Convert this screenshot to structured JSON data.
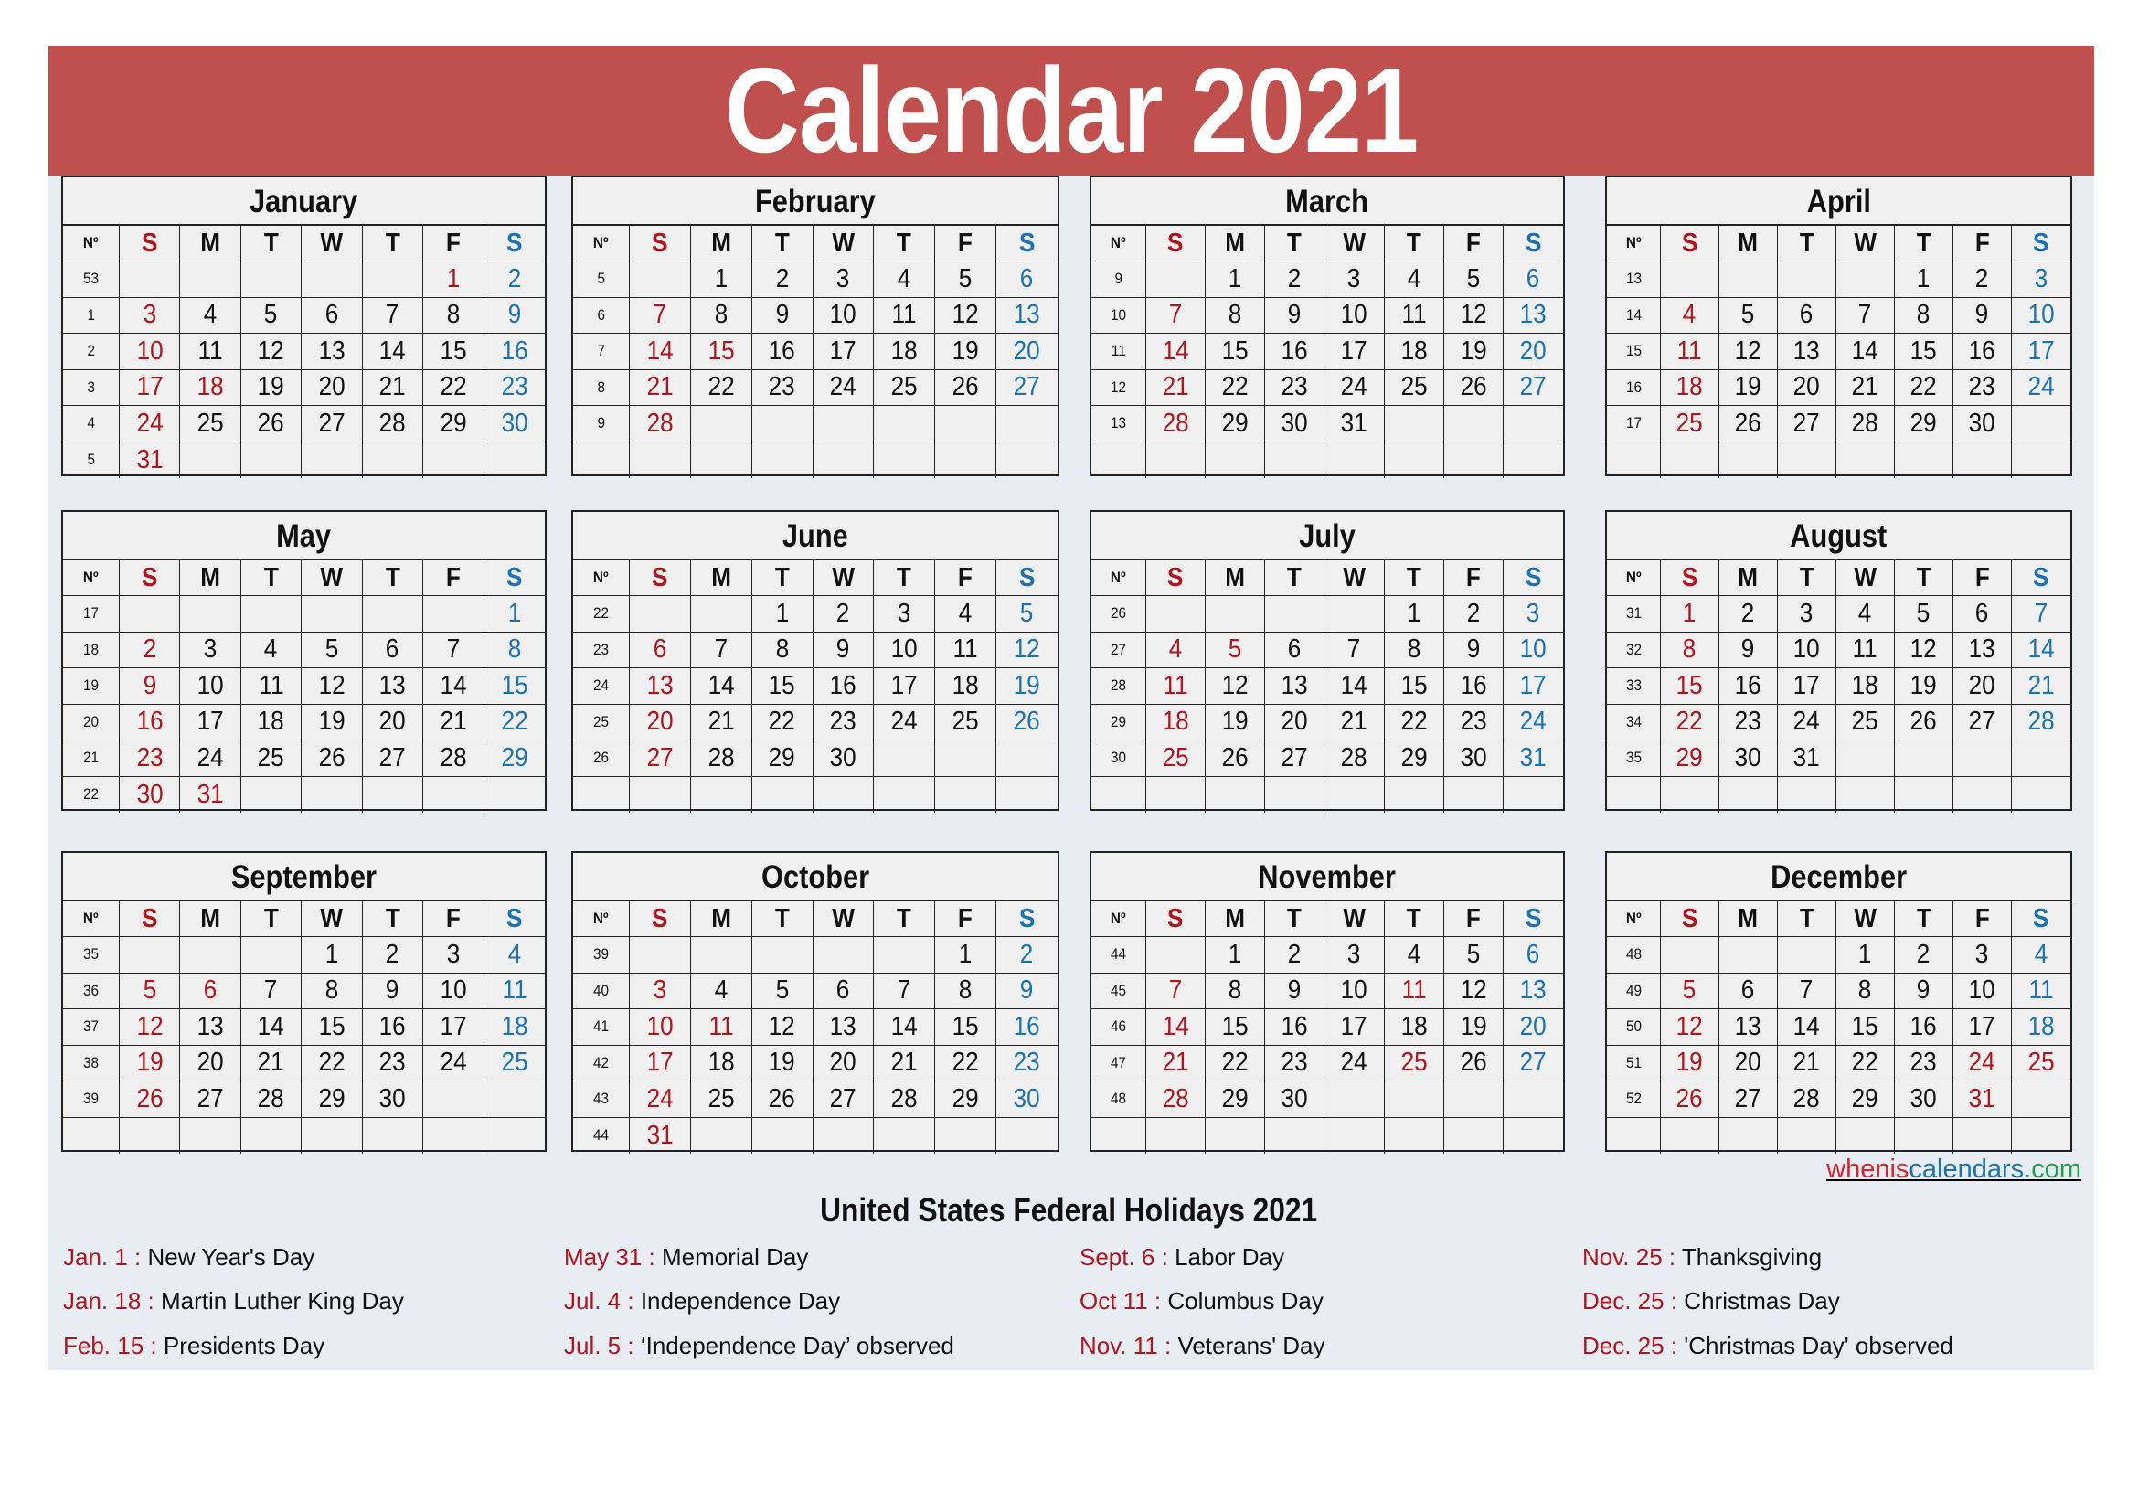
{
  "title": "Calendar 2021",
  "colors": {
    "banner": "#c0504d",
    "background": "#e8ecf3",
    "cell": "#f0f0f0",
    "sunday": "#b0141c",
    "saturday": "#1c72b0",
    "holiday": "#b0141c"
  },
  "weekday_headers": [
    "Nº",
    "S",
    "M",
    "T",
    "W",
    "T",
    "F",
    "S"
  ],
  "months": [
    {
      "name": "January",
      "weeks": [
        53,
        1,
        2,
        3,
        4,
        5
      ],
      "first_weekday": 5,
      "days": 31,
      "holidays": [
        1,
        18
      ]
    },
    {
      "name": "February",
      "weeks": [
        5,
        6,
        7,
        8,
        9,
        ""
      ],
      "first_weekday": 1,
      "days": 28,
      "holidays": [
        15
      ]
    },
    {
      "name": "March",
      "weeks": [
        9,
        10,
        11,
        12,
        13,
        ""
      ],
      "first_weekday": 1,
      "days": 31,
      "holidays": []
    },
    {
      "name": "April",
      "weeks": [
        13,
        14,
        15,
        16,
        17,
        ""
      ],
      "first_weekday": 4,
      "days": 30,
      "holidays": []
    },
    {
      "name": "May",
      "weeks": [
        17,
        18,
        19,
        20,
        21,
        22
      ],
      "first_weekday": 6,
      "days": 31,
      "holidays": [
        31
      ]
    },
    {
      "name": "June",
      "weeks": [
        22,
        23,
        24,
        25,
        26,
        ""
      ],
      "first_weekday": 2,
      "days": 30,
      "holidays": []
    },
    {
      "name": "July",
      "weeks": [
        26,
        27,
        28,
        29,
        30,
        ""
      ],
      "first_weekday": 4,
      "days": 31,
      "holidays": [
        4,
        5
      ]
    },
    {
      "name": "August",
      "weeks": [
        31,
        32,
        33,
        34,
        35,
        ""
      ],
      "first_weekday": 0,
      "days": 31,
      "holidays": []
    },
    {
      "name": "September",
      "weeks": [
        35,
        36,
        37,
        38,
        39,
        ""
      ],
      "first_weekday": 3,
      "days": 30,
      "holidays": [
        6
      ]
    },
    {
      "name": "October",
      "weeks": [
        39,
        40,
        41,
        42,
        43,
        44
      ],
      "first_weekday": 5,
      "days": 31,
      "holidays": [
        11
      ]
    },
    {
      "name": "November",
      "weeks": [
        44,
        45,
        46,
        47,
        48,
        ""
      ],
      "first_weekday": 1,
      "days": 30,
      "holidays": [
        11,
        25
      ]
    },
    {
      "name": "December",
      "weeks": [
        48,
        49,
        50,
        51,
        52,
        ""
      ],
      "first_weekday": 3,
      "days": 31,
      "holidays": [
        24,
        25,
        31
      ]
    }
  ],
  "website": {
    "part1": "whenis",
    "part2": "calendars",
    "part3": ".com"
  },
  "holidays_title": "United States Federal Holidays 2021",
  "holidays": [
    [
      {
        "date": "Jan. 1 :",
        "name": "New Year's Day"
      },
      {
        "date": "Jan. 18 :",
        "name": "Martin Luther King Day"
      },
      {
        "date": "Feb. 15 :",
        "name": "Presidents Day"
      }
    ],
    [
      {
        "date": "May 31 :",
        "name": "Memorial Day"
      },
      {
        "date": "Jul. 4 :",
        "name": "Independence Day"
      },
      {
        "date": "Jul. 5 :",
        "name": "‘Independence Day’ observed"
      }
    ],
    [
      {
        "date": "Sept. 6 :",
        "name": "Labor Day"
      },
      {
        "date": "Oct 11 :",
        "name": "Columbus Day"
      },
      {
        "date": "Nov. 11 :",
        "name": "Veterans' Day"
      }
    ],
    [
      {
        "date": "Nov. 25 :",
        "name": "Thanksgiving"
      },
      {
        "date": "Dec. 25 :",
        "name": "Christmas Day"
      },
      {
        "date": "Dec. 25 :",
        "name": "'Christmas Day' observed"
      }
    ]
  ]
}
